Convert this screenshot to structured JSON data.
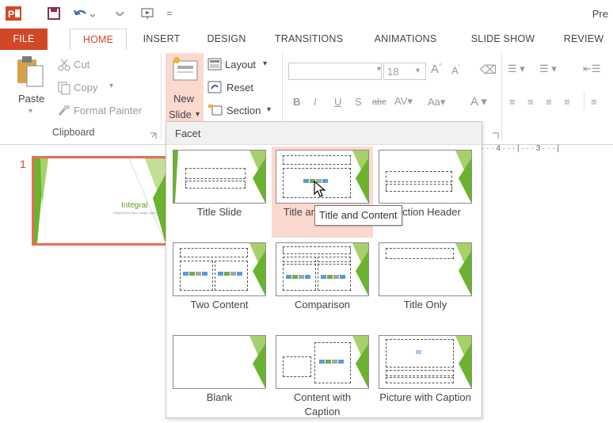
{
  "titlebar": {
    "app_icon": "powerpoint-icon",
    "title_fragment": "Pre"
  },
  "tabs": [
    {
      "label": "FILE"
    },
    {
      "label": "HOME"
    },
    {
      "label": "INSERT"
    },
    {
      "label": "DESIGN"
    },
    {
      "label": "TRANSITIONS"
    },
    {
      "label": "ANIMATIONS"
    },
    {
      "label": "SLIDE SHOW"
    },
    {
      "label": "REVIEW"
    }
  ],
  "clipboard": {
    "paste": "Paste",
    "cut": "Cut",
    "copy": "Copy",
    "format_painter": "Format Painter",
    "group_label": "Clipboard"
  },
  "slides": {
    "new_slide_line1": "New",
    "new_slide_line2": "Slide",
    "layout": "Layout",
    "reset": "Reset",
    "section": "Section"
  },
  "font": {
    "size": "18"
  },
  "slide_pane": {
    "number": "1",
    "theme_title": "Integral",
    "theme_subtitle": "Insight goes here, insight appear"
  },
  "ruler": {
    "marks": "· · · 4 · · · | · · · 3 · · · |"
  },
  "gallery": {
    "header": "Facet",
    "layouts": [
      {
        "label": "Title Slide"
      },
      {
        "label": "Title and Content"
      },
      {
        "label": "Section Header"
      },
      {
        "label": "Two Content"
      },
      {
        "label": "Comparison"
      },
      {
        "label": "Title Only"
      },
      {
        "label": "Blank"
      },
      {
        "label": "Content with Caption"
      },
      {
        "label": "Picture with Caption"
      }
    ]
  },
  "tooltip": {
    "text": "Title and Content"
  },
  "colors": {
    "accent": "#d24726",
    "hover": "#fcd9cf",
    "theme_green": "#7ab733"
  }
}
